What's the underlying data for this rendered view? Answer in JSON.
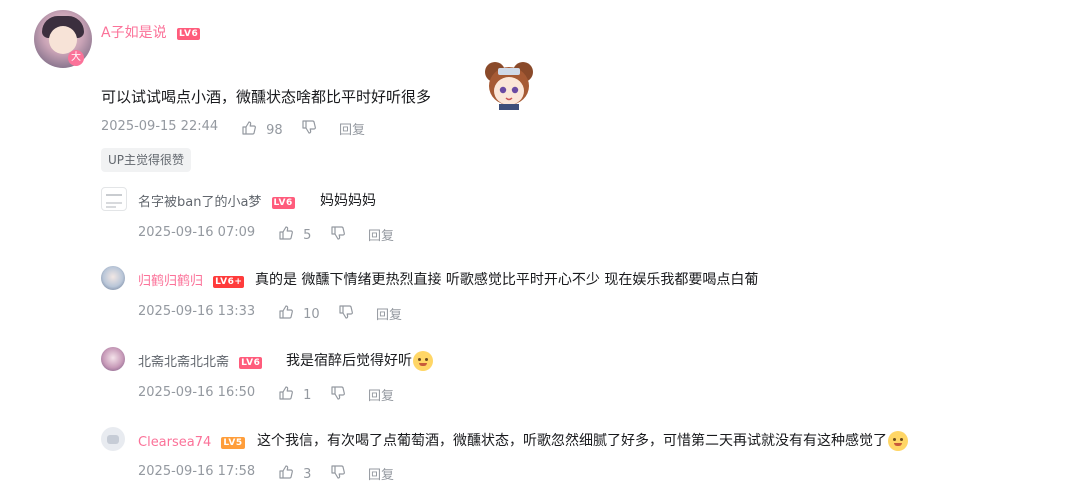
{
  "main_comment": {
    "username": "A子如是说",
    "level": "LV6",
    "avatar_badge": "大",
    "text": "可以试试喝点小酒，微醺状态啥都比平时好听很多",
    "time": "2025-09-15 22:44",
    "likes": "98",
    "reply_label": "回复",
    "up_tag": "UP主觉得很赞"
  },
  "replies": [
    {
      "username": "名字被ban了的小a梦",
      "level": "LV6",
      "text": "妈妈妈妈",
      "time": "2025-09-16 07:09",
      "likes": "5",
      "reply_label": "回复",
      "name_color": "#61666d"
    },
    {
      "username": "归鹤归鹤归",
      "level": "LV6+",
      "text": "真的是 微醺下情绪更热烈直接 听歌感觉比平时开心不少 现在娱乐我都要喝点白葡",
      "time": "2025-09-16 13:33",
      "likes": "10",
      "reply_label": "回复",
      "name_color": "#fb7299"
    },
    {
      "username": "北斋北斋北北斋",
      "level": "LV6",
      "text": "我是宿醉后觉得好听",
      "time": "2025-09-16 16:50",
      "likes": "1",
      "reply_label": "回复",
      "name_color": "#61666d"
    },
    {
      "username": "Clearsea74",
      "level": "LV5",
      "text": "这个我信，有次喝了点葡萄酒，微醺状态，听歌忽然细腻了好多，可惜第二天再试就没有有这种感觉了",
      "time": "2025-09-16 17:58",
      "likes": "3",
      "reply_label": "回复",
      "name_color": "#fb7299"
    }
  ],
  "colors": {
    "accent_pink": "#fb7299",
    "meta_gray": "#9499a0",
    "text_dark": "#18191c"
  }
}
